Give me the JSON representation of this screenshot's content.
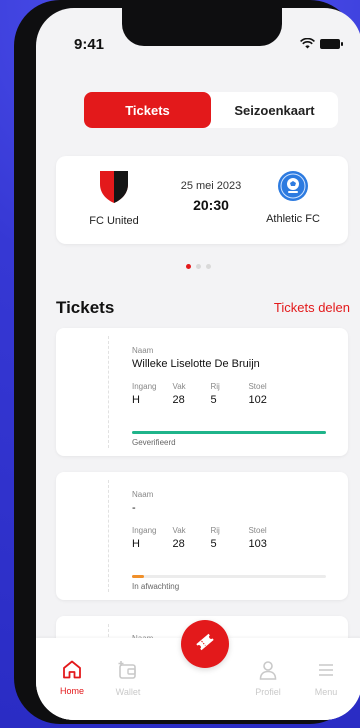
{
  "status_bar": {
    "time": "9:41"
  },
  "segments": [
    {
      "label": "Tickets",
      "active": true
    },
    {
      "label": "Seizoenkaart",
      "active": false
    }
  ],
  "match": {
    "date": "25 mei 2023",
    "time": "20:30",
    "home_team": "FC United",
    "away_team": "Athletic FC"
  },
  "carousel": {
    "pages": 3,
    "active_index": 0
  },
  "tickets_section": {
    "title": "Tickets",
    "share_label": "Tickets delen"
  },
  "ticket_labels": {
    "name": "Naam",
    "entrance": "Ingang",
    "section": "Vak",
    "row": "Rij",
    "seat": "Stoel"
  },
  "tickets": [
    {
      "name": "Willeke Liselotte De Bruijn",
      "entrance": "H",
      "section": "28",
      "row": "5",
      "seat": "102",
      "status": "Geverifieerd",
      "status_color": "#1fb48a",
      "progress_percent": 100
    },
    {
      "name": "-",
      "entrance": "H",
      "section": "28",
      "row": "5",
      "seat": "103",
      "status": "In afwachting",
      "status_color": "#f0902a",
      "progress_percent": 6
    },
    {
      "name": ""
    }
  ],
  "tab_bar": {
    "items": [
      {
        "label": "Home",
        "icon": "home-icon",
        "active": true
      },
      {
        "label": "Wallet",
        "icon": "wallet-icon",
        "active": false
      },
      {
        "label": "Profiel",
        "icon": "profile-icon",
        "active": false
      },
      {
        "label": "Menu",
        "icon": "menu-icon",
        "active": false
      }
    ],
    "center_action_icon": "ticket-icon"
  },
  "colors": {
    "accent": "#e3191b",
    "verified": "#1fb48a",
    "pending": "#f0902a"
  }
}
